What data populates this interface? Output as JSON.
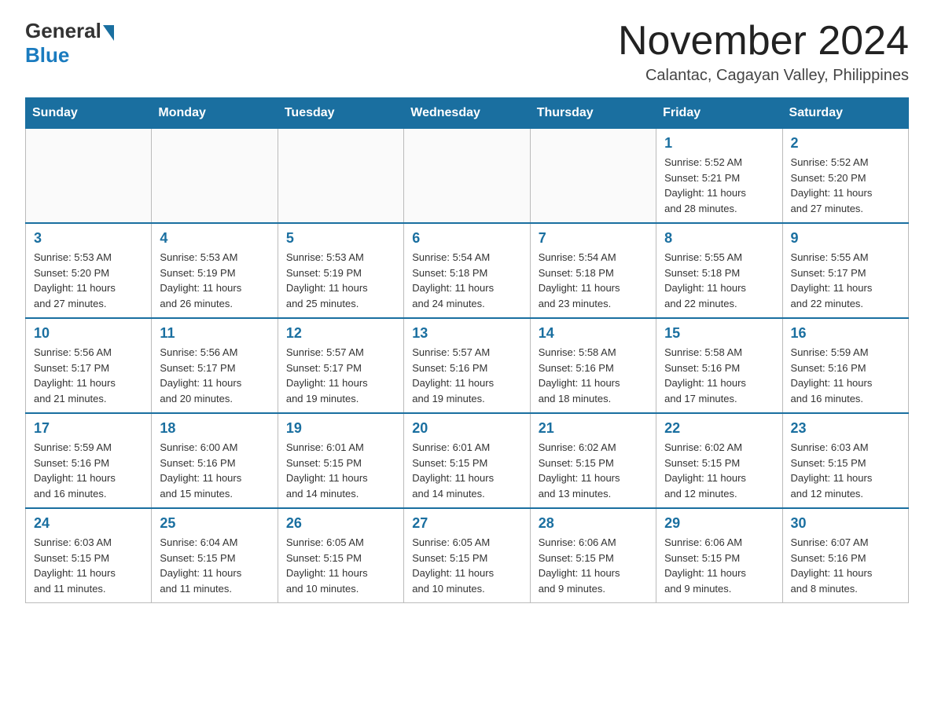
{
  "header": {
    "logo_general": "General",
    "logo_blue": "Blue",
    "month_title": "November 2024",
    "location": "Calantac, Cagayan Valley, Philippines"
  },
  "days_of_week": [
    "Sunday",
    "Monday",
    "Tuesday",
    "Wednesday",
    "Thursday",
    "Friday",
    "Saturday"
  ],
  "weeks": [
    {
      "days": [
        {
          "num": "",
          "info": ""
        },
        {
          "num": "",
          "info": ""
        },
        {
          "num": "",
          "info": ""
        },
        {
          "num": "",
          "info": ""
        },
        {
          "num": "",
          "info": ""
        },
        {
          "num": "1",
          "info": "Sunrise: 5:52 AM\nSunset: 5:21 PM\nDaylight: 11 hours\nand 28 minutes."
        },
        {
          "num": "2",
          "info": "Sunrise: 5:52 AM\nSunset: 5:20 PM\nDaylight: 11 hours\nand 27 minutes."
        }
      ]
    },
    {
      "days": [
        {
          "num": "3",
          "info": "Sunrise: 5:53 AM\nSunset: 5:20 PM\nDaylight: 11 hours\nand 27 minutes."
        },
        {
          "num": "4",
          "info": "Sunrise: 5:53 AM\nSunset: 5:19 PM\nDaylight: 11 hours\nand 26 minutes."
        },
        {
          "num": "5",
          "info": "Sunrise: 5:53 AM\nSunset: 5:19 PM\nDaylight: 11 hours\nand 25 minutes."
        },
        {
          "num": "6",
          "info": "Sunrise: 5:54 AM\nSunset: 5:18 PM\nDaylight: 11 hours\nand 24 minutes."
        },
        {
          "num": "7",
          "info": "Sunrise: 5:54 AM\nSunset: 5:18 PM\nDaylight: 11 hours\nand 23 minutes."
        },
        {
          "num": "8",
          "info": "Sunrise: 5:55 AM\nSunset: 5:18 PM\nDaylight: 11 hours\nand 22 minutes."
        },
        {
          "num": "9",
          "info": "Sunrise: 5:55 AM\nSunset: 5:17 PM\nDaylight: 11 hours\nand 22 minutes."
        }
      ]
    },
    {
      "days": [
        {
          "num": "10",
          "info": "Sunrise: 5:56 AM\nSunset: 5:17 PM\nDaylight: 11 hours\nand 21 minutes."
        },
        {
          "num": "11",
          "info": "Sunrise: 5:56 AM\nSunset: 5:17 PM\nDaylight: 11 hours\nand 20 minutes."
        },
        {
          "num": "12",
          "info": "Sunrise: 5:57 AM\nSunset: 5:17 PM\nDaylight: 11 hours\nand 19 minutes."
        },
        {
          "num": "13",
          "info": "Sunrise: 5:57 AM\nSunset: 5:16 PM\nDaylight: 11 hours\nand 19 minutes."
        },
        {
          "num": "14",
          "info": "Sunrise: 5:58 AM\nSunset: 5:16 PM\nDaylight: 11 hours\nand 18 minutes."
        },
        {
          "num": "15",
          "info": "Sunrise: 5:58 AM\nSunset: 5:16 PM\nDaylight: 11 hours\nand 17 minutes."
        },
        {
          "num": "16",
          "info": "Sunrise: 5:59 AM\nSunset: 5:16 PM\nDaylight: 11 hours\nand 16 minutes."
        }
      ]
    },
    {
      "days": [
        {
          "num": "17",
          "info": "Sunrise: 5:59 AM\nSunset: 5:16 PM\nDaylight: 11 hours\nand 16 minutes."
        },
        {
          "num": "18",
          "info": "Sunrise: 6:00 AM\nSunset: 5:16 PM\nDaylight: 11 hours\nand 15 minutes."
        },
        {
          "num": "19",
          "info": "Sunrise: 6:01 AM\nSunset: 5:15 PM\nDaylight: 11 hours\nand 14 minutes."
        },
        {
          "num": "20",
          "info": "Sunrise: 6:01 AM\nSunset: 5:15 PM\nDaylight: 11 hours\nand 14 minutes."
        },
        {
          "num": "21",
          "info": "Sunrise: 6:02 AM\nSunset: 5:15 PM\nDaylight: 11 hours\nand 13 minutes."
        },
        {
          "num": "22",
          "info": "Sunrise: 6:02 AM\nSunset: 5:15 PM\nDaylight: 11 hours\nand 12 minutes."
        },
        {
          "num": "23",
          "info": "Sunrise: 6:03 AM\nSunset: 5:15 PM\nDaylight: 11 hours\nand 12 minutes."
        }
      ]
    },
    {
      "days": [
        {
          "num": "24",
          "info": "Sunrise: 6:03 AM\nSunset: 5:15 PM\nDaylight: 11 hours\nand 11 minutes."
        },
        {
          "num": "25",
          "info": "Sunrise: 6:04 AM\nSunset: 5:15 PM\nDaylight: 11 hours\nand 11 minutes."
        },
        {
          "num": "26",
          "info": "Sunrise: 6:05 AM\nSunset: 5:15 PM\nDaylight: 11 hours\nand 10 minutes."
        },
        {
          "num": "27",
          "info": "Sunrise: 6:05 AM\nSunset: 5:15 PM\nDaylight: 11 hours\nand 10 minutes."
        },
        {
          "num": "28",
          "info": "Sunrise: 6:06 AM\nSunset: 5:15 PM\nDaylight: 11 hours\nand 9 minutes."
        },
        {
          "num": "29",
          "info": "Sunrise: 6:06 AM\nSunset: 5:15 PM\nDaylight: 11 hours\nand 9 minutes."
        },
        {
          "num": "30",
          "info": "Sunrise: 6:07 AM\nSunset: 5:16 PM\nDaylight: 11 hours\nand 8 minutes."
        }
      ]
    }
  ]
}
